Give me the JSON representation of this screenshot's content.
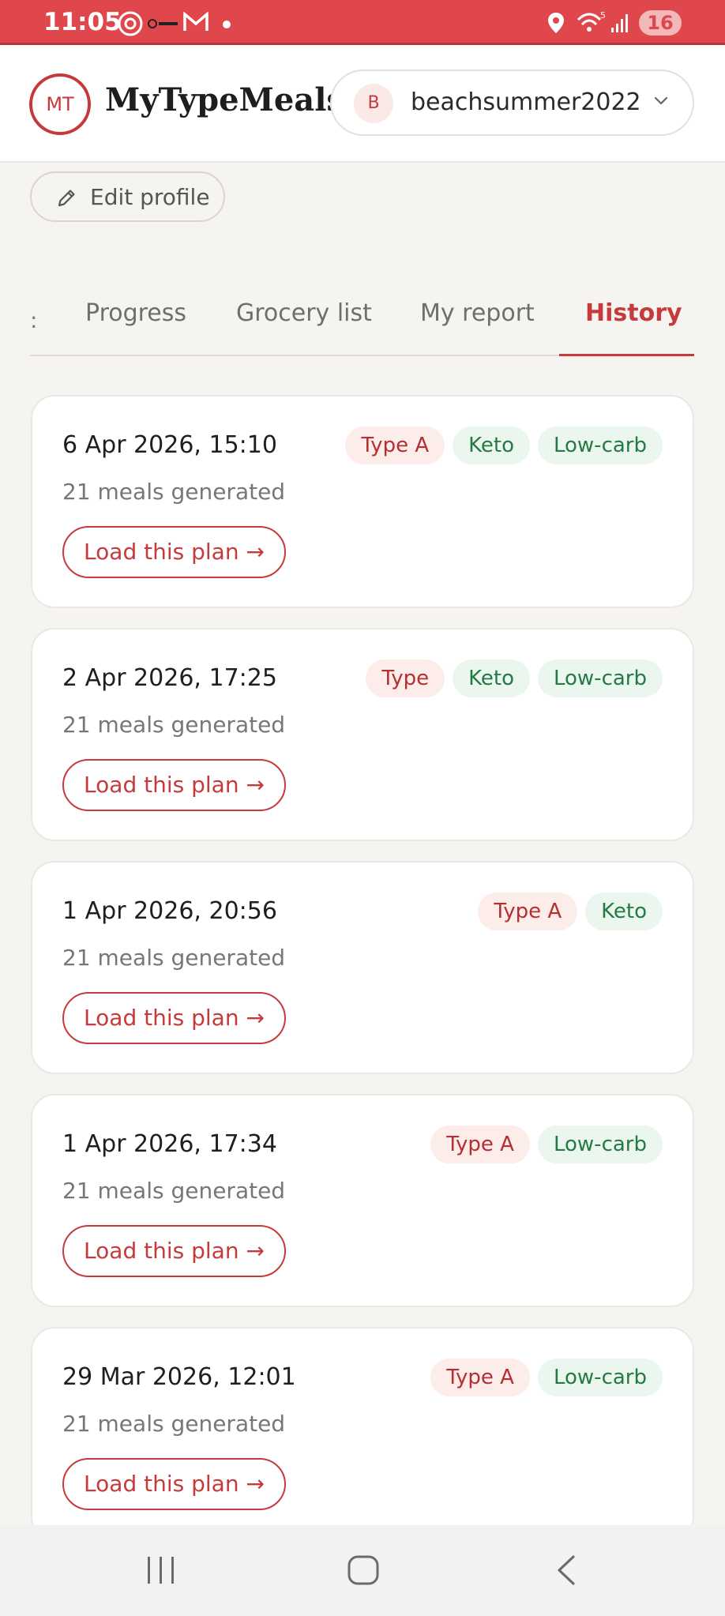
{
  "status_bar": {
    "time": "11:05",
    "battery": "16",
    "icons": [
      "threads-icon",
      "notification-icon",
      "gmail-icon",
      "dot-icon",
      "location-icon",
      "wifi-icon",
      "signal-icon",
      "battery-icon"
    ]
  },
  "header": {
    "logo_initials": "MT",
    "app_title": "MyTypeMeals",
    "account": {
      "avatar_initial": "B",
      "username": "beachsummer2022"
    }
  },
  "profile": {
    "edit_label": "Edit profile"
  },
  "tabs": {
    "partial_stub": ":",
    "items": [
      {
        "label": "Progress",
        "active": false
      },
      {
        "label": "Grocery list",
        "active": false
      },
      {
        "label": "My report",
        "active": false
      },
      {
        "label": "History",
        "active": true
      }
    ]
  },
  "history": [
    {
      "date": "6 Apr 2026, 15:10",
      "meta": "21 meals generated",
      "tags": [
        {
          "label": "Type A",
          "kind": "red"
        },
        {
          "label": "Keto",
          "kind": "green"
        },
        {
          "label": "Low-carb",
          "kind": "green"
        }
      ],
      "action": "Load this plan →"
    },
    {
      "date": "2 Apr 2026, 17:25",
      "meta": "21 meals generated",
      "tags": [
        {
          "label": "Type",
          "kind": "red"
        },
        {
          "label": "Keto",
          "kind": "green"
        },
        {
          "label": "Low-carb",
          "kind": "green"
        }
      ],
      "action": "Load this plan →"
    },
    {
      "date": "1 Apr 2026, 20:56",
      "meta": "21 meals generated",
      "tags": [
        {
          "label": "Type A",
          "kind": "red"
        },
        {
          "label": "Keto",
          "kind": "green"
        }
      ],
      "action": "Load this plan →"
    },
    {
      "date": "1 Apr 2026, 17:34",
      "meta": "21 meals generated",
      "tags": [
        {
          "label": "Type A",
          "kind": "red"
        },
        {
          "label": "Low-carb",
          "kind": "green"
        }
      ],
      "action": "Load this plan →"
    },
    {
      "date": "29 Mar 2026, 12:01",
      "meta": "21 meals generated",
      "tags": [
        {
          "label": "Type A",
          "kind": "red"
        },
        {
          "label": "Low-carb",
          "kind": "green"
        }
      ],
      "action": "Load this plan →"
    }
  ],
  "colors": {
    "accent": "#c63a3c",
    "status_bar": "#e0474c",
    "tag_red_bg": "#fcecea",
    "tag_green_bg": "#eaf6ee",
    "tag_green_text": "#257a43"
  },
  "nav_bar": {
    "buttons": [
      "recents-icon",
      "home-icon",
      "back-icon"
    ]
  }
}
